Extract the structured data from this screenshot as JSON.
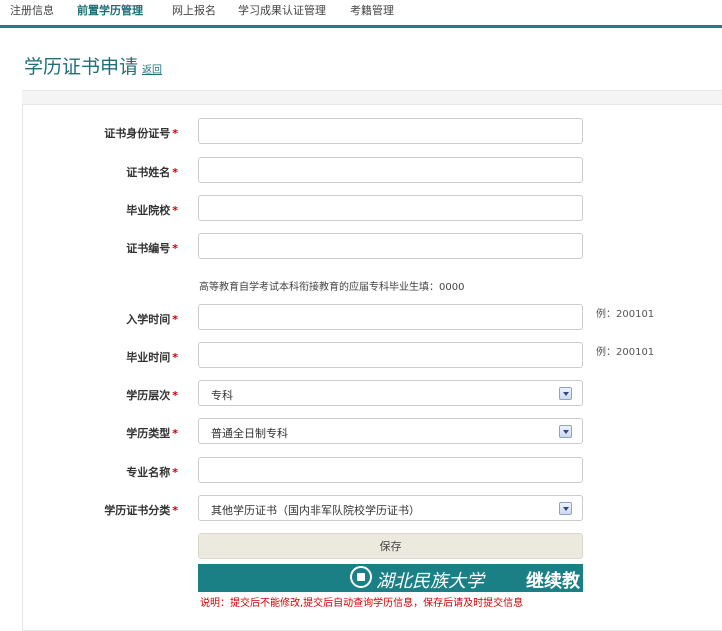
{
  "nav": {
    "items": [
      {
        "label": "注册信息",
        "active": false
      },
      {
        "label": "前置学历管理",
        "active": true
      },
      {
        "label": "网上报名",
        "active": false
      },
      {
        "label": "学习成果认证管理",
        "active": false
      },
      {
        "label": "考籍管理",
        "active": false
      }
    ]
  },
  "page": {
    "title": "学历证书申请",
    "back_label": "返回"
  },
  "form": {
    "id_number": {
      "label": "证书身份证号",
      "required": "*",
      "value": ""
    },
    "name": {
      "label": "证书姓名",
      "required": "*",
      "value": ""
    },
    "school": {
      "label": "毕业院校",
      "required": "*",
      "value": ""
    },
    "cert_no": {
      "label": "证书编号",
      "required": "*",
      "value": ""
    },
    "note": "高等教育自学考试本科衔接教育的应届专科毕业生填：0000",
    "enroll_time": {
      "label": "入学时间",
      "required": "*",
      "value": "",
      "hint": "例：200101"
    },
    "grad_time": {
      "label": "毕业时间",
      "required": "*",
      "value": "",
      "hint": "例：200101"
    },
    "level": {
      "label": "学历层次",
      "required": "*",
      "selected": "专科"
    },
    "type": {
      "label": "学历类型",
      "required": "*",
      "selected": "普通全日制专科"
    },
    "major": {
      "label": "专业名称",
      "required": "*",
      "value": ""
    },
    "category": {
      "label": "学历证书分类",
      "required": "*",
      "selected": "其他学历证书（国内非军队院校学历证书）"
    },
    "save_label": "保存"
  },
  "banner": {
    "university": "湖北民族大学",
    "suffix": "继续教"
  },
  "notice": "说明：提交后不能修改,提交后自动查询学历信息，保存后请及时提交信息",
  "colors": {
    "accent": "#1f7f86",
    "required": "#cc0000",
    "notice": "#d00000"
  }
}
